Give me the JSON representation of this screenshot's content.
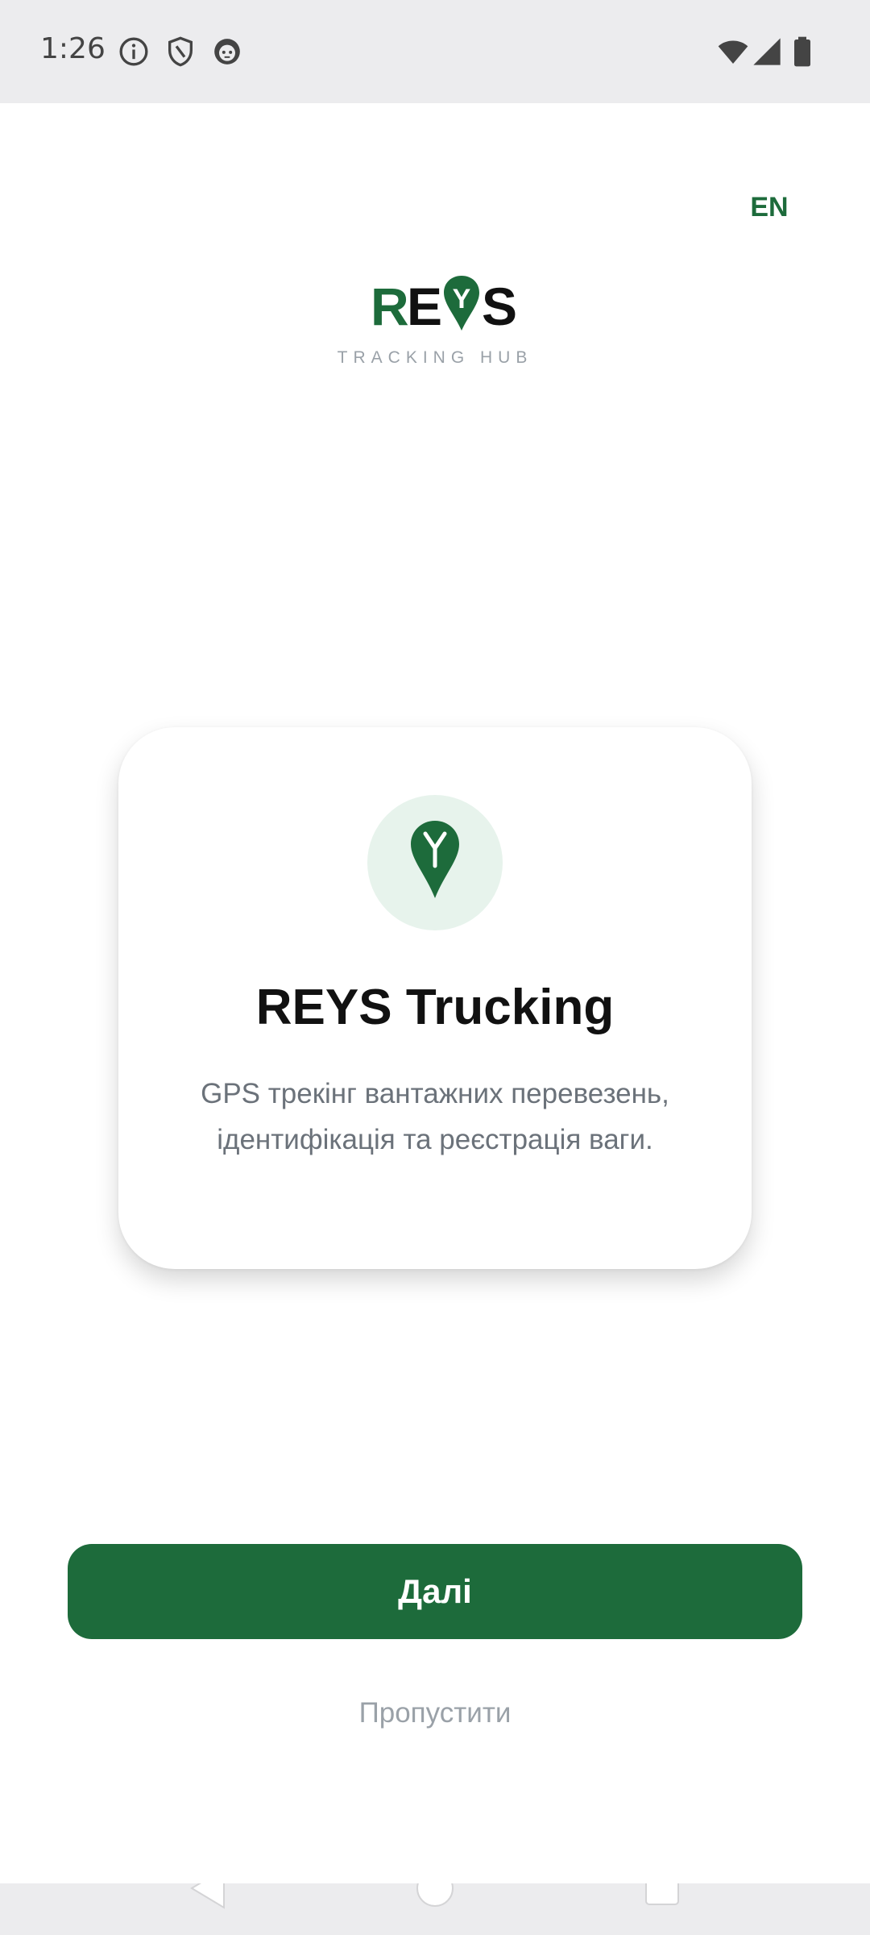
{
  "status_bar": {
    "time": "1:26",
    "left_icons": [
      "info-icon",
      "shield-icon",
      "robot-face-icon"
    ],
    "right_icons": [
      "wifi-icon",
      "cell-signal-icon",
      "battery-icon"
    ]
  },
  "language": {
    "label": "EN"
  },
  "logo": {
    "letters": [
      "R",
      "E",
      "S"
    ],
    "pin_letter": "Y",
    "tagline": "TRACKING HUB"
  },
  "card": {
    "icon": "map-pin-y-icon",
    "title": "REYS Trucking",
    "description": "GPS трекінг вантажних перевезень, ідентифікація та реєстрація ваги."
  },
  "actions": {
    "next_label": "Далі",
    "skip_label": "Пропустити"
  },
  "colors": {
    "brand_green": "#1d6b3b",
    "icon_circle_bg": "#e7f3ec",
    "muted_text": "#9aa1a8",
    "status_bar_bg": "#ececee"
  },
  "nav_bar": {
    "buttons": [
      "back-icon",
      "home-icon",
      "recents-icon"
    ]
  }
}
